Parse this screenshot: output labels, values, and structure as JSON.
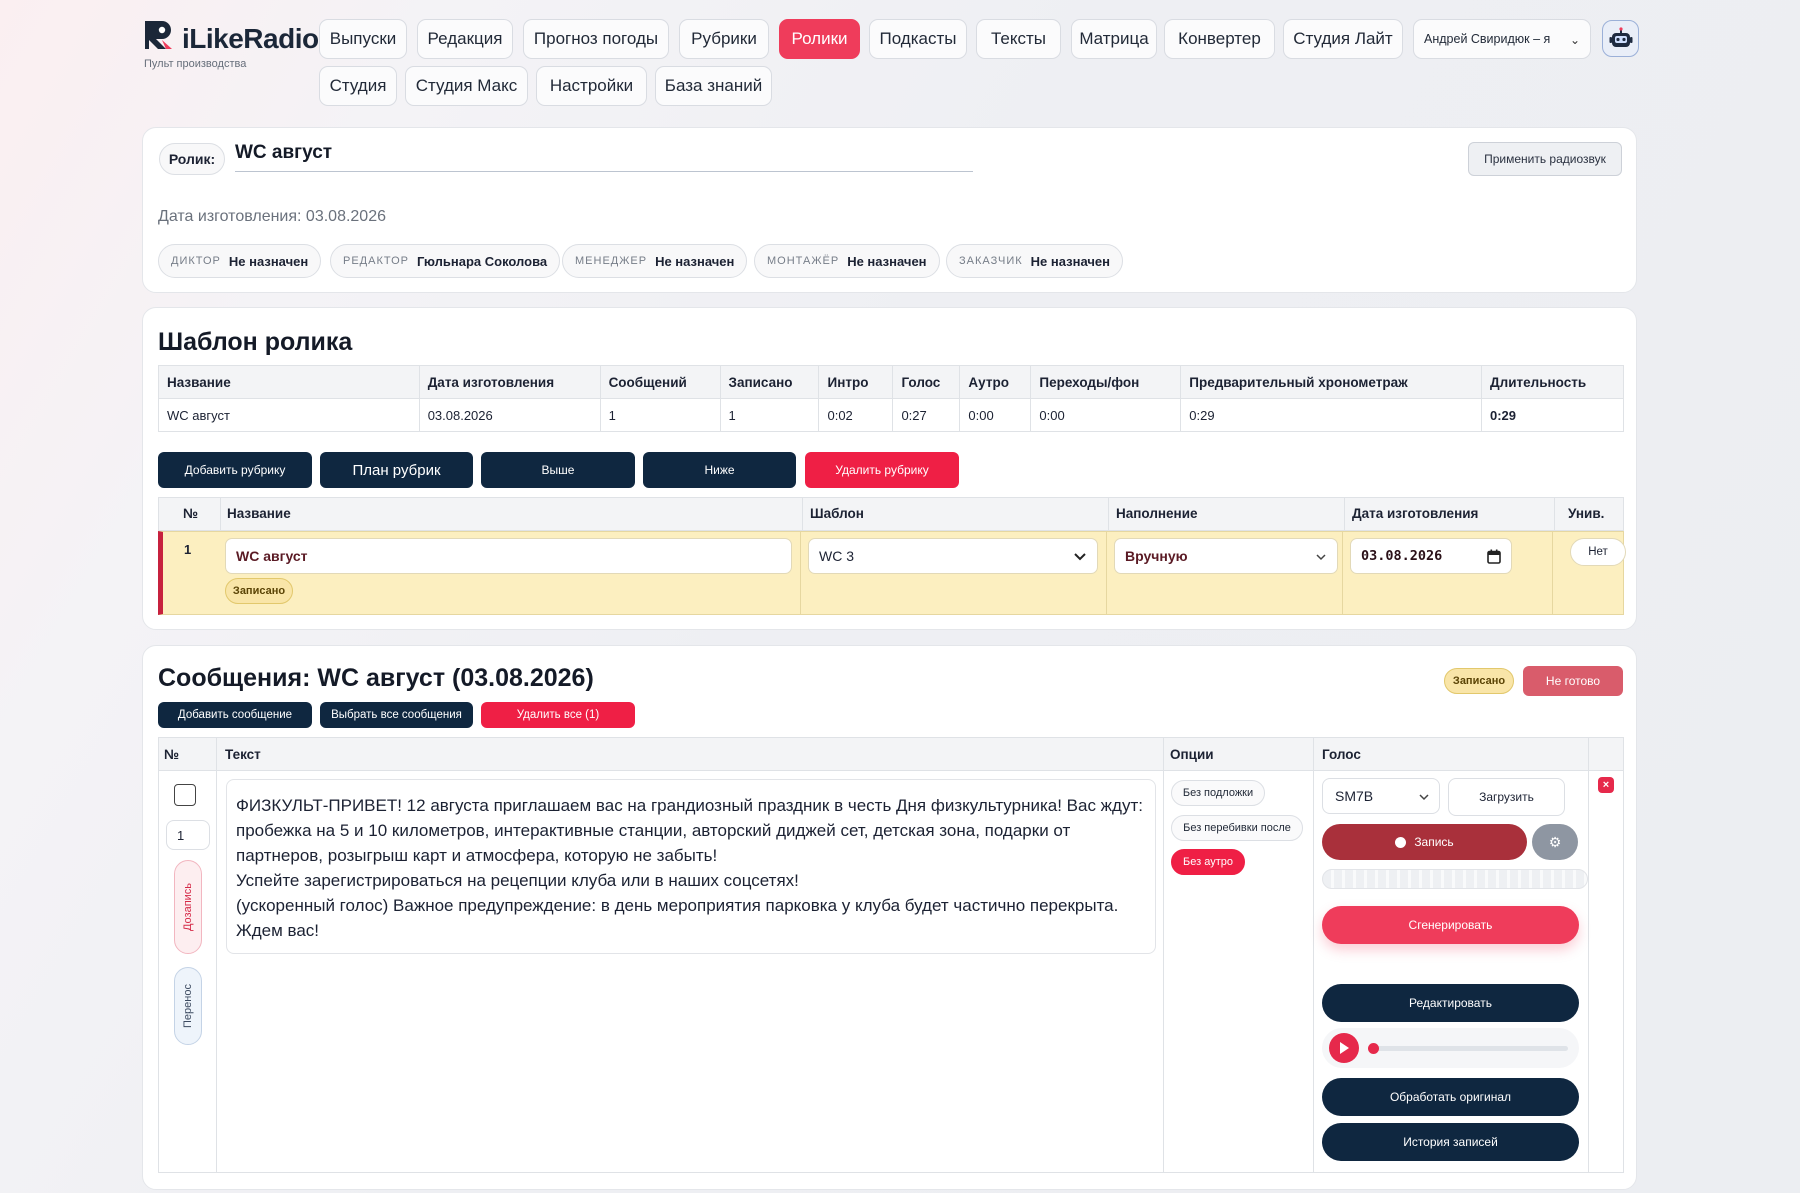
{
  "brand": {
    "name": "iLikeRadio",
    "subtitle": "Пульт производства"
  },
  "nav": {
    "row1": [
      "Выпуски",
      "Редакция",
      "Прогноз погоды",
      "Рубрики",
      "Ролики",
      "Подкасты",
      "Тексты",
      "Матрица",
      "Конвертер",
      "Студия Лайт"
    ],
    "row2": [
      "Студия",
      "Студия Макс",
      "Настройки",
      "База знаний"
    ],
    "active": "Ролики",
    "user": "Андрей Свиридюк – я"
  },
  "roll": {
    "label": "Ролик:",
    "name": "WC август",
    "apply_button": "Применить радиозвук",
    "made_date_text": "Дата изготовления: 03.08.2026",
    "roles": [
      {
        "label": "ДИКТОР",
        "value": "Не назначен"
      },
      {
        "label": "РЕДАКТОР",
        "value": "Гюльнара Соколова"
      },
      {
        "label": "МЕНЕДЖЕР",
        "value": "Не назначен"
      },
      {
        "label": "МОНТАЖЁР",
        "value": "Не назначен"
      },
      {
        "label": "ЗАКАЗЧИК",
        "value": "Не назначен"
      }
    ]
  },
  "template": {
    "title": "Шаблон ролика",
    "columns": [
      "Название",
      "Дата изготовления",
      "Сообщений",
      "Записано",
      "Интро",
      "Голос",
      "Аутро",
      "Переходы/фон",
      "Предварительный хронометраж",
      "Длительность"
    ],
    "row": [
      "WC август",
      "03.08.2026",
      "1",
      "1",
      "0:02",
      "0:27",
      "0:00",
      "0:00",
      "0:29",
      "0:29"
    ],
    "buttons": {
      "add": "Добавить рубрику",
      "plan": "План рубрик",
      "up": "Выше",
      "down": "Ниже",
      "delete": "Удалить рубрику"
    },
    "rubric_columns": [
      "№",
      "Название",
      "Шаблон",
      "Наполнение",
      "Дата изготовления",
      "Унив."
    ],
    "rubric": {
      "num": "1",
      "name": "WC август",
      "badge": "Записано",
      "template": "WC 3",
      "fill": "Вручную",
      "date": "03.08.2026",
      "univ": "Нет"
    }
  },
  "messages": {
    "title": "Сообщения: WC август (03.08.2026)",
    "status_recorded": "Записано",
    "status_not_ready": "Не готово",
    "buttons": {
      "add": "Добавить сообщение",
      "select_all": "Выбрать все сообщения",
      "delete_all": "Удалить все (1)"
    },
    "columns": [
      "№",
      "Текст",
      "Опции",
      "Голос"
    ],
    "item": {
      "num": "1",
      "side_rerecord": "Дозапись",
      "side_move": "Перенос",
      "text": "ФИЗКУЛЬТ-ПРИВЕТ! 12 августа приглашаем вас на грандиозный праздник в честь Дня физкультурника! Вас ждут: пробежка на 5 и 10 километров, интерактивные станции, авторский диджей сет, детская зона, подарки от партнеров, розыгрыш карт и атмосфера, которую не забыть!\nУспейте зарегистрироваться на рецепции клуба или в наших соцсетях!\n(ускоренный голос) Важное предупреждение: в день мероприятия парковка у клуба будет частично перекрыта. Ждем вас!",
      "options": [
        "Без подложки",
        "Без перебивки после",
        "Без аутро"
      ],
      "voice": "SM7B",
      "upload": "Загрузить",
      "record": "Запись",
      "generate": "Сгенерировать",
      "edit": "Редактировать",
      "process": "Обработать оригинал",
      "history": "История записей",
      "close": "×"
    }
  },
  "colors": {
    "accent": "#ef3c5b",
    "dark": "#0f2740",
    "danger": "#ef1f45",
    "highlight": "#fcefc0"
  }
}
